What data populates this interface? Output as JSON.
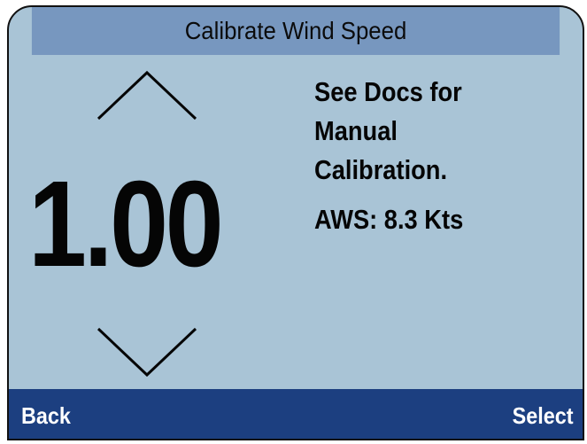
{
  "title": "Calibrate Wind Speed",
  "value": "1.00",
  "info": {
    "line1": "See Docs for",
    "line2": "Manual",
    "line3": "Calibration.",
    "aws": "AWS: 8.3 Kts"
  },
  "softkeys": {
    "left": "Back",
    "right": "Select"
  },
  "icons": {
    "increase": "chevron-up-icon",
    "decrease": "chevron-down-icon"
  },
  "colors": {
    "title_bar": "#7797bf",
    "background": "#a9c4d6",
    "softkey_bar": "#1c3f80",
    "softkey_text": "#ffffff",
    "text": "#050505"
  }
}
